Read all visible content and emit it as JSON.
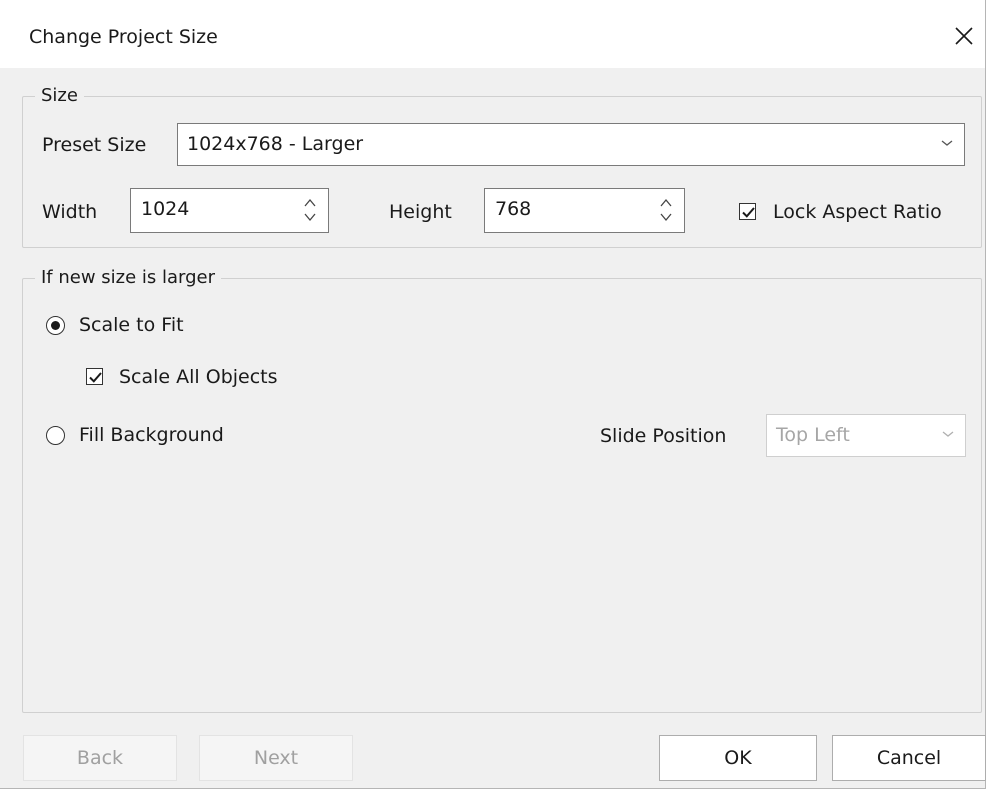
{
  "window": {
    "title": "Change Project Size"
  },
  "size_group": {
    "legend": "Size",
    "preset_label": "Preset Size",
    "preset_value": "1024x768 - Larger",
    "width_label": "Width",
    "width_value": "1024",
    "height_label": "Height",
    "height_value": "768",
    "lock_label": "Lock Aspect Ratio",
    "lock_checked": true
  },
  "larger_group": {
    "legend": "If new size is larger",
    "scale_to_fit_label": "Scale to Fit",
    "scale_to_fit_selected": true,
    "scale_all_label": "Scale All Objects",
    "scale_all_checked": true,
    "fill_background_label": "Fill Background",
    "fill_background_selected": false,
    "slide_position_label": "Slide Position",
    "slide_position_value": "Top Left"
  },
  "buttons": {
    "back": "Back",
    "next": "Next",
    "ok": "OK",
    "cancel": "Cancel"
  },
  "icons": {
    "close": "close-icon",
    "dropdown": "chevron-down-icon",
    "spinner": "spinner-arrows-icon",
    "check": "checkmark-icon"
  }
}
